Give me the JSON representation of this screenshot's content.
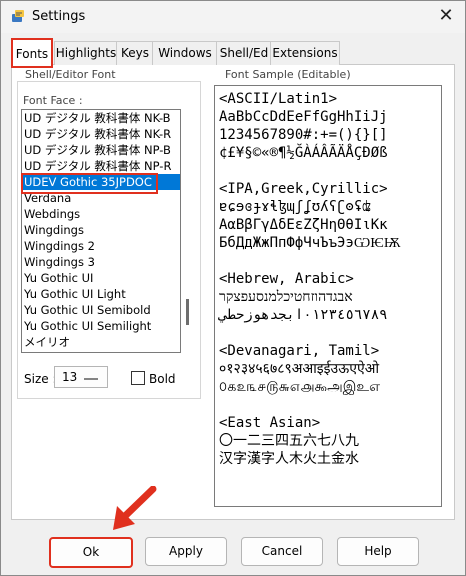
{
  "window": {
    "title": "Settings",
    "close_glyph": "✕"
  },
  "tabs": [
    "Fonts",
    "Highlights",
    "Keys",
    "Windows",
    "Shell/Ed",
    "Extensions"
  ],
  "font_group": {
    "title": "Shell/Editor Font",
    "face_label": "Font Face :",
    "items": [
      "UD デジタル 教科書体 NK-B",
      "UD デジタル 教科書体 NK-R",
      "UD デジタル 教科書体 NP-B",
      "UD デジタル 教科書体 NP-R",
      "UDEV Gothic 35JPDOC",
      "Verdana",
      "Webdings",
      "Wingdings",
      "Wingdings 2",
      "Wingdings 3",
      "Yu Gothic UI",
      "Yu Gothic UI Light",
      "Yu Gothic UI Semibold",
      "Yu Gothic UI Semilight",
      "メイリオ"
    ],
    "selected_index": 4,
    "size_label": "Size :",
    "size_value": "13",
    "bold_label": "Bold",
    "bold_checked": false
  },
  "sample": {
    "title": "Font Sample (Editable)",
    "lines": [
      "<ASCII/Latin1>",
      "AaBbCcDdEeFfGgHhIiJj",
      "1234567890#:+=(){}[]",
      "¢£¥§©«®¶½ĞÀÁÂÃÄÅÇÐØß",
      "",
      "<IPA,Greek,Cyrillic>",
      "ɐɕɘɞɟɤɬɮɰʃʆʊʎʕʗʘʢʥ",
      "ΑαΒβΓγΔδΕεΖζΗηΘθΙιΚκ",
      "БбДдЖжПпФфЧчЪъЭэѠѤѬ",
      "",
      "<Hebrew, Arabic>",
      "אבגדהוזחטיכלמנסעפצקר",
      "٠١٢٣٤٥٦٧٨٩ابجدهوزحطي",
      "",
      "<Devanagari, Tamil>",
      "०१२३४५६७८९अआइईउऊएऐओ",
      "௦௧௨௩௪௫௬௭௮௯அஇஉஎ",
      "",
      "<East Asian>",
      "〇一二三四五六七八九",
      "汉字漢字人木火土金水"
    ]
  },
  "buttons": {
    "ok": "Ok",
    "apply": "Apply",
    "cancel": "Cancel",
    "help": "Help"
  },
  "colors": {
    "accent_highlight": "#e0301e",
    "selection": "#0078d7"
  }
}
